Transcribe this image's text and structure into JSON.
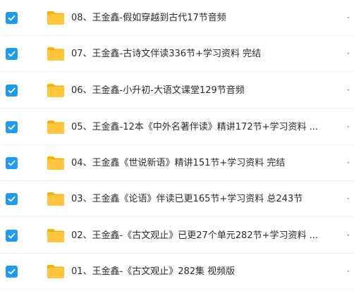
{
  "files": [
    {
      "name": "08、王金鑫-假如穿越到古代17节音频",
      "checked": true,
      "more": "·"
    },
    {
      "name": "07、王金鑫-古诗文伴读336节+学习资料 完结",
      "checked": true,
      "more": "·"
    },
    {
      "name": "06、王金鑫-小升初-大语文课堂129节音频",
      "checked": true,
      "more": "·"
    },
    {
      "name": "05、王金鑫-12本《中外名著伴读》精讲172节+学习资料 ...",
      "checked": true,
      "more": "·"
    },
    {
      "name": "04、王金鑫《世说新语》精讲151节+学习资料 完结",
      "checked": true,
      "more": "·"
    },
    {
      "name": "03、王金鑫《论语》伴读已更165节+学习资料 总243节",
      "checked": true,
      "more": "·"
    },
    {
      "name": "02、王金鑫-《古文观止》已更27个单元282节+学习资料 ...",
      "checked": true,
      "more": "·"
    },
    {
      "name": "01、王金鑫-《古文观止》282集 视频版",
      "checked": true,
      "more": "·"
    }
  ],
  "colors": {
    "checkbox": "#1e9bf0",
    "folder": "#ffc53d",
    "folder_tab": "#f5b300"
  },
  "icons": {
    "checkbox": "checkmark-icon",
    "folder": "folder-icon"
  }
}
